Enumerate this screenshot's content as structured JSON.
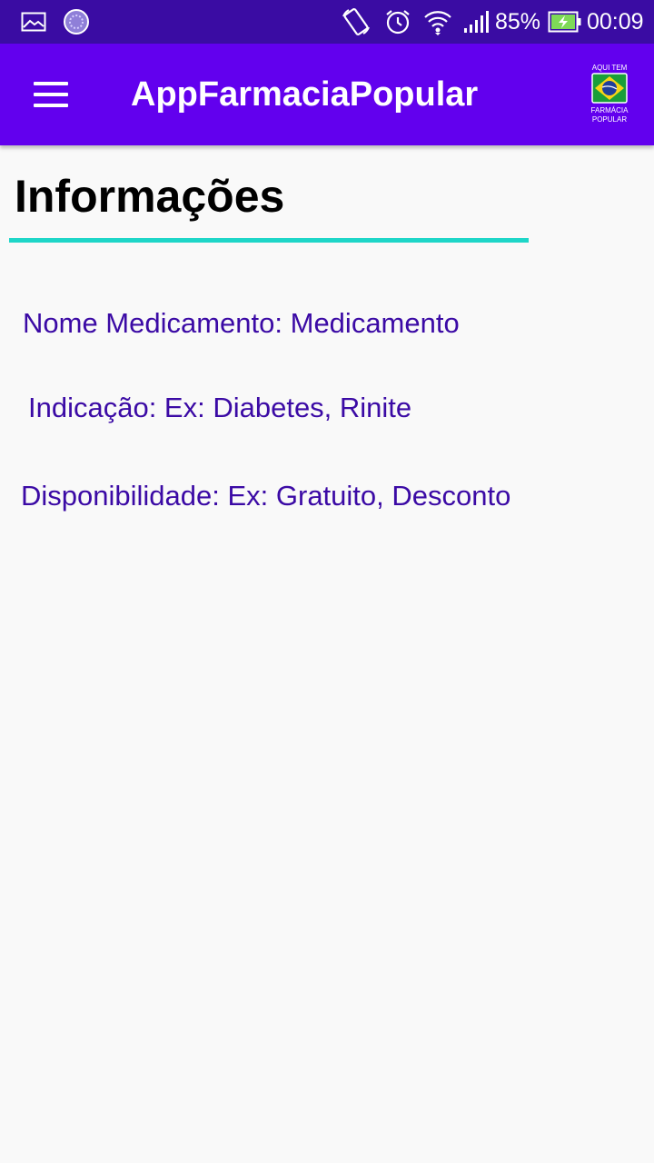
{
  "status_bar": {
    "battery_percent": "85%",
    "time": "00:09",
    "icons": [
      "image-notification-icon",
      "sync-notification-icon",
      "rotate-icon",
      "alarm-icon",
      "wifi-icon",
      "signal-icon",
      "battery-charging-icon"
    ]
  },
  "app_bar": {
    "title": "AppFarmaciaPopular",
    "logo_text_top": "AQUI TEM",
    "logo_text_bottom_1": "FARMÁCIA",
    "logo_text_bottom_2": "POPULAR"
  },
  "main": {
    "heading": "Informações",
    "fields": [
      {
        "label": "Nome Medicamento: Medicamento"
      },
      {
        "label": "Indicação: Ex: Diabetes, Rinite"
      },
      {
        "label": "Disponibilidade: Ex: Gratuito, Desconto"
      }
    ]
  },
  "colors": {
    "status_bar": "#3a0ca3",
    "app_bar": "#6200ee",
    "accent_underline": "#1ed6c8",
    "info_text": "#3b0aa5"
  }
}
